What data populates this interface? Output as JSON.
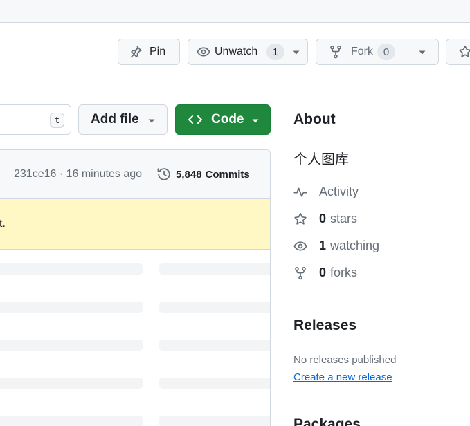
{
  "colors": {
    "primary_button": "#1f883d",
    "link": "#0969da",
    "banner_bg": "#fff8c5",
    "muted_text": "#656d76",
    "border": "#d0d7de"
  },
  "header_actions": {
    "pin": {
      "label": "Pin",
      "icon": "pin-icon"
    },
    "watch": {
      "label": "Unwatch",
      "count": "1",
      "icon": "eye-icon"
    },
    "fork": {
      "label": "Fork",
      "count": "0",
      "icon": "repo-forked-icon",
      "disabled": true
    },
    "star": {
      "icon": "star-icon"
    }
  },
  "file_nav": {
    "go_to_file_shortcut": "t",
    "add_file_label": "Add file",
    "code_label": "Code"
  },
  "latest_commit": {
    "ref": "231ce16 · 16 minutes ago",
    "commits_count": "5,848",
    "commits_label": "Commits"
  },
  "banner": {
    "text": "t."
  },
  "about": {
    "title": "About",
    "description": "个人图库",
    "activity_label": "Activity",
    "stars_count": "0",
    "stars_label": "stars",
    "watching_count": "1",
    "watching_label": "watching",
    "forks_count": "0",
    "forks_label": "forks"
  },
  "releases": {
    "title": "Releases",
    "empty_text": "No releases published",
    "create_link": "Create a new release"
  },
  "packages": {
    "title": "Packages"
  }
}
